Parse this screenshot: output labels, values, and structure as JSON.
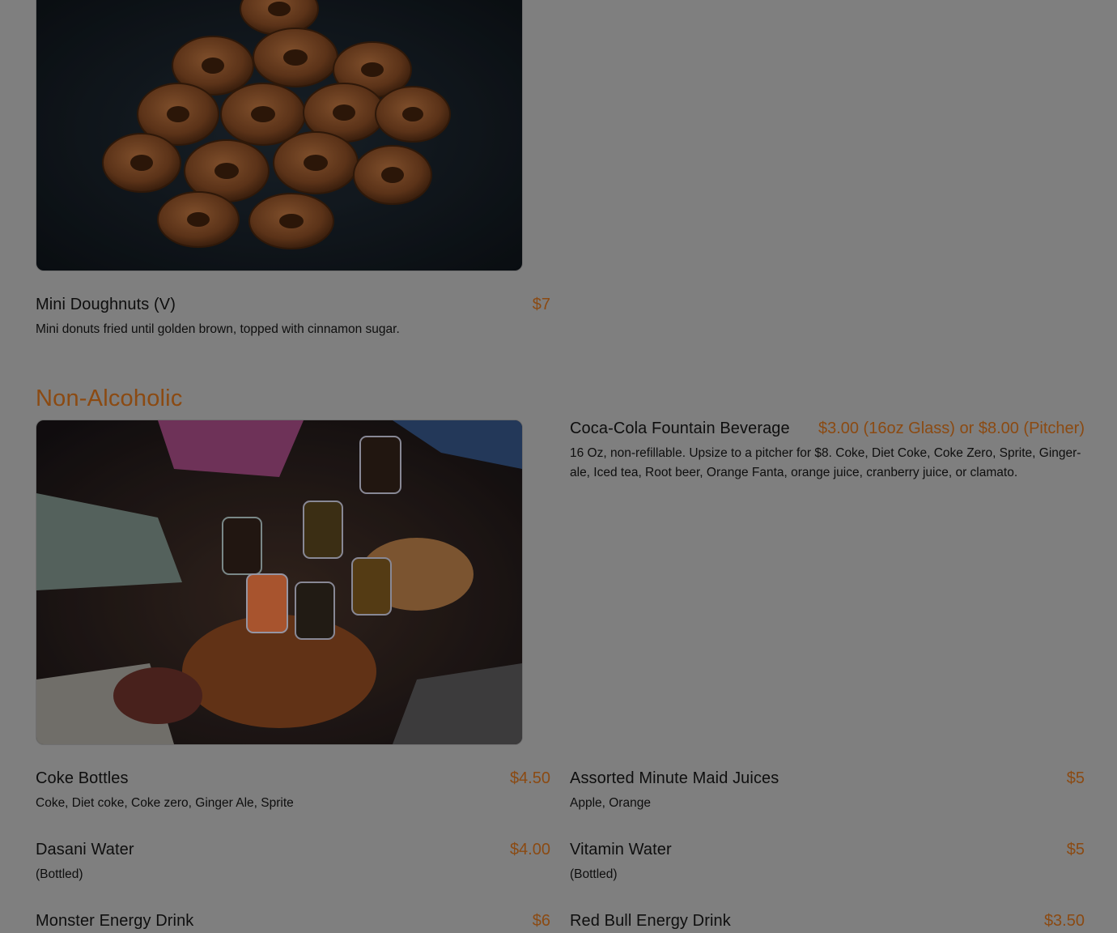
{
  "colors": {
    "background": "#7f7f7f",
    "accent": "#8b4a12",
    "text": "#0e0e0e"
  },
  "desserts": {
    "image": "mini-doughnuts-photo",
    "items": [
      {
        "name": "Mini Doughnuts (V)",
        "price": "$7",
        "description": "Mini donuts fried until golden brown, topped with cinnamon sugar."
      }
    ]
  },
  "non_alcoholic": {
    "title": "Non-Alcoholic",
    "image": "friends-toasting-drinks-photo",
    "featured": {
      "name": "Coca-Cola Fountain Beverage",
      "price": "$3.00 (16oz Glass) or $8.00 (Pitcher)",
      "description": "16 Oz, non-refillable. Upsize to a pitcher for $8. Coke, Diet Coke, Coke Zero, Sprite, Ginger-ale, Iced tea, Root beer, Orange Fanta, orange juice, cranberry juice, or clamato."
    },
    "items": [
      {
        "name": "Coke Bottles",
        "price": "$4.50",
        "description": "Coke, Diet coke, Coke zero, Ginger Ale, Sprite"
      },
      {
        "name": "Assorted Minute Maid Juices",
        "price": "$5",
        "description": "Apple, Orange"
      },
      {
        "name": "Dasani Water",
        "price": "$4.00",
        "description": "(Bottled)"
      },
      {
        "name": "Vitamin Water",
        "price": "$5",
        "description": "(Bottled)"
      },
      {
        "name": "Monster Energy Drink",
        "price": "$6",
        "description": ""
      },
      {
        "name": "Red Bull Energy Drink",
        "price": "$3.50",
        "description": ""
      }
    ]
  }
}
